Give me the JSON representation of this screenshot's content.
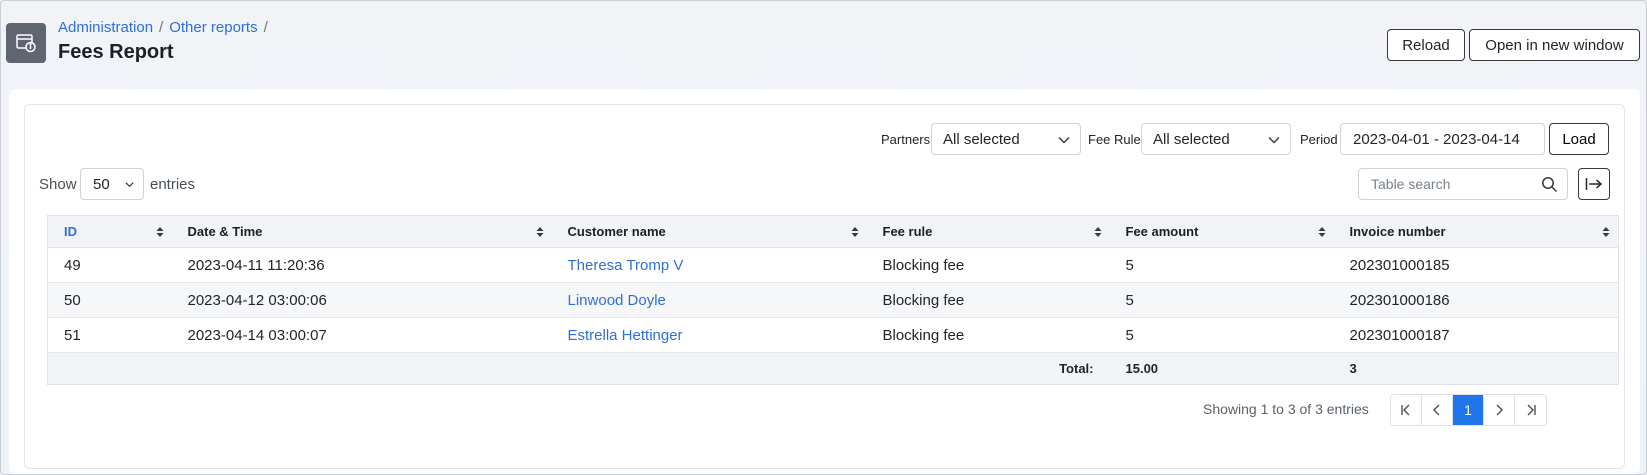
{
  "header": {
    "breadcrumbs": [
      "Administration",
      "Other reports"
    ],
    "separator": "/",
    "title": "Fees Report",
    "reload_label": "Reload",
    "open_new_window_label": "Open in new window"
  },
  "filters": {
    "partners_label": "Partners",
    "partners_value": "All selected",
    "fee_rule_label": "Fee Rule",
    "fee_rule_value": "All selected",
    "period_label": "Period",
    "period_value": "2023-04-01 - 2023-04-14",
    "load_label": "Load"
  },
  "length": {
    "show_label": "Show",
    "value": "50",
    "entries_label": "entries"
  },
  "search": {
    "placeholder": "Table search"
  },
  "table": {
    "columns": [
      "ID",
      "Date & Time",
      "Customer name",
      "Fee rule",
      "Fee amount",
      "Invoice number"
    ],
    "sorted_column": "ID",
    "rows": [
      {
        "id": "49",
        "datetime": "2023-04-11 11:20:36",
        "customer": "Theresa Tromp V",
        "fee_rule": "Blocking fee",
        "fee_amount": "5",
        "invoice": "202301000185"
      },
      {
        "id": "50",
        "datetime": "2023-04-12 03:00:06",
        "customer": "Linwood Doyle",
        "fee_rule": "Blocking fee",
        "fee_amount": "5",
        "invoice": "202301000186"
      },
      {
        "id": "51",
        "datetime": "2023-04-14 03:00:07",
        "customer": "Estrella Hettinger",
        "fee_rule": "Blocking fee",
        "fee_amount": "5",
        "invoice": "202301000187"
      }
    ],
    "footer": {
      "total_label": "Total:",
      "fee_total": "15.00",
      "invoice_count": "3"
    }
  },
  "pagination": {
    "info": "Showing 1 to 3 of 3 entries",
    "current_page": "1"
  },
  "colors": {
    "accent": "#1f75ea",
    "link": "#2f6fd8",
    "icon_bg": "#5f6672"
  }
}
